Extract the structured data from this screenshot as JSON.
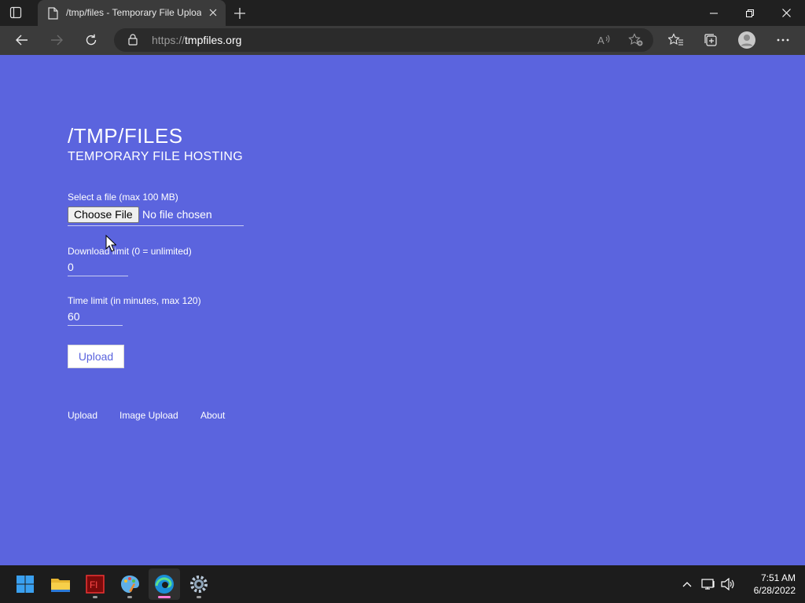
{
  "browser": {
    "tab_title": "/tmp/files - Temporary File Upload",
    "url_prefix": "https://",
    "url_host": "tmpfiles.org"
  },
  "page": {
    "title": "/TMP/FILES",
    "subtitle": "TEMPORARY FILE HOSTING",
    "file_label": "Select a file (max 100 MB)",
    "choose_file": "Choose File",
    "no_file": "No file chosen",
    "download_limit_label": "Download limit (0 = unlimited)",
    "download_limit_value": "0",
    "time_limit_label": "Time limit (in minutes, max 120)",
    "time_limit_value": "60",
    "upload_button": "Upload",
    "footer_links": [
      "Upload",
      "Image Upload",
      "About"
    ]
  },
  "colors": {
    "page_bg": "#5b64de",
    "browser_chrome": "#3b3b3b",
    "taskbar": "#1c1c1c"
  },
  "taskbar": {
    "time": "7:51 AM",
    "date": "6/28/2022",
    "apps": [
      "windows-start-icon",
      "file-explorer-icon",
      "flash-icon",
      "paint-icon",
      "edge-icon",
      "settings-icon"
    ]
  }
}
